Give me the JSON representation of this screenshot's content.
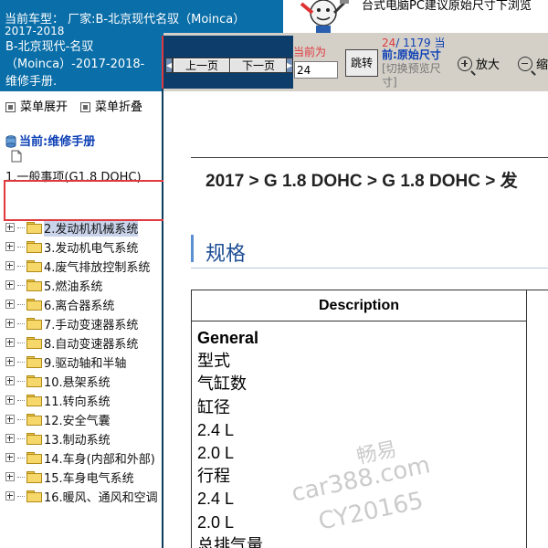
{
  "window": {
    "title_line1": "当前车型：  厂家:B-北京现代名驭（Moinca）",
    "title_line2": "2017-2018"
  },
  "ad_banner": {
    "text": "台式电脑PC建议原始尺寸下浏览"
  },
  "sidebar": {
    "model_header": "B-北京现代-名驭（Moinca）-2017-2018- 维修手册.",
    "expand_all": "菜单展开",
    "collapse_all": "菜单折叠",
    "current_label": "当前:维修手册",
    "tree_root": "1.一般事项(G1.8 DOHC)",
    "items": [
      {
        "label": "2.发动机机械系统",
        "selected": true
      },
      {
        "label": "3.发动机电气系统",
        "selected": false
      },
      {
        "label": "4.废气排放控制系统",
        "selected": false
      },
      {
        "label": "5.燃油系统",
        "selected": false
      },
      {
        "label": "6.离合器系统",
        "selected": false
      },
      {
        "label": "7.手动变速器系统",
        "selected": false
      },
      {
        "label": "8.自动变速器系统",
        "selected": false
      },
      {
        "label": "9.驱动轴和半轴",
        "selected": false
      },
      {
        "label": "10.悬架系统",
        "selected": false
      },
      {
        "label": "11.转向系统",
        "selected": false
      },
      {
        "label": "12.安全气囊",
        "selected": false
      },
      {
        "label": "13.制动系统",
        "selected": false
      },
      {
        "label": "14.车身(内部和外部)",
        "selected": false
      },
      {
        "label": "15.车身电气系统",
        "selected": false
      },
      {
        "label": "16.暖风、通风和空调",
        "selected": false
      }
    ]
  },
  "toolbar": {
    "prev_label": "上一页",
    "next_label": "下一页",
    "current_page_label": "当前为",
    "page_input_value": "24",
    "jump_label": "跳转",
    "page_current": "24",
    "page_total": "/ 1179",
    "page_suffix": "当",
    "size_current_prefix": "前:",
    "size_current": "原始尺寸",
    "size_switch": "[切换预览尺寸]",
    "zoom_in_label": "放大",
    "zoom_out_label": "缩"
  },
  "document": {
    "breadcrumb": "2017 > G 1.8 DOHC > G 1.8 DOHC > 发",
    "section_title": "规格",
    "table_header": "Description",
    "rows": [
      {
        "text": "General",
        "bold": true
      },
      {
        "text": "型式",
        "bold": false
      },
      {
        "text": "气缸数",
        "bold": false
      },
      {
        "text": "缸径",
        "bold": false
      },
      {
        "text": "2.4 L",
        "bold": false
      },
      {
        "text": "2.0 L",
        "bold": false
      },
      {
        "text": "行程",
        "bold": false
      },
      {
        "text": "2.4 L",
        "bold": false
      },
      {
        "text": "2.0 L",
        "bold": false
      },
      {
        "text": "总排气量",
        "bold": false
      }
    ]
  },
  "watermark": {
    "line1": "畅易",
    "line2": "car388.com",
    "line3": "CY20165"
  },
  "colors": {
    "accent_blue": "#0a6ea8",
    "nav_dark": "#0c3d6b",
    "highlight_red": "#e0393e",
    "link_blue": "#0b3fb5"
  }
}
